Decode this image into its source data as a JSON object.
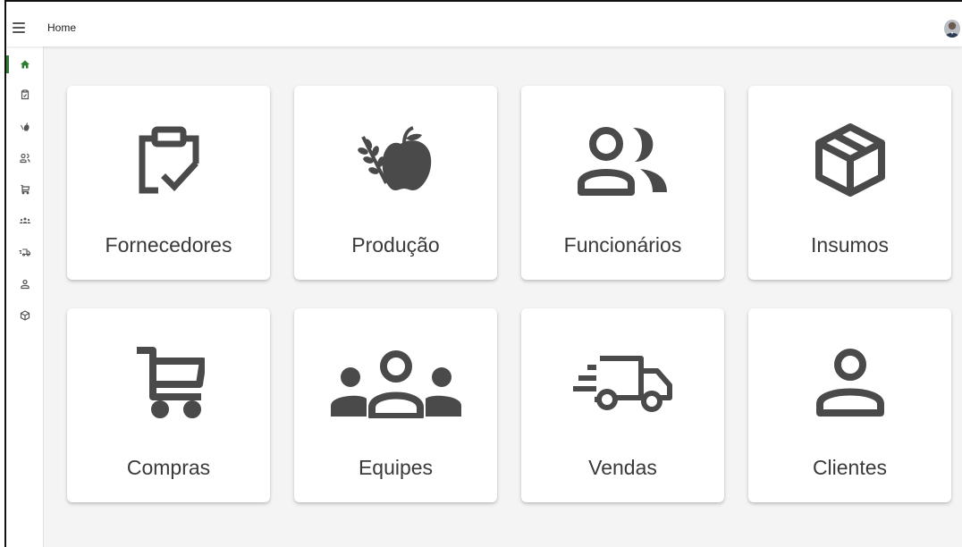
{
  "header": {
    "title": "Home",
    "menu_icon": "hamburger-menu-icon",
    "avatar_icon": "user-avatar"
  },
  "colors": {
    "icon": "#4a4a4a",
    "active_nav": "#2e7d32",
    "background": "#f4f4f4",
    "card": "#ffffff"
  },
  "sidebar": {
    "items": [
      {
        "icon": "home-icon",
        "active": true
      },
      {
        "icon": "clipboard-check-icon"
      },
      {
        "icon": "apple-wheat-icon"
      },
      {
        "icon": "users-icon"
      },
      {
        "icon": "cart-icon"
      },
      {
        "icon": "team-icon"
      },
      {
        "icon": "truck-icon"
      },
      {
        "icon": "person-icon"
      },
      {
        "icon": "box-icon"
      }
    ]
  },
  "cards": [
    {
      "label": "Fornecedores",
      "icon": "clipboard-check-icon"
    },
    {
      "label": "Produção",
      "icon": "apple-wheat-icon"
    },
    {
      "label": "Funcionários",
      "icon": "users-icon"
    },
    {
      "label": "Insumos",
      "icon": "box-icon"
    },
    {
      "label": "Compras",
      "icon": "cart-icon"
    },
    {
      "label": "Equipes",
      "icon": "team-icon"
    },
    {
      "label": "Vendas",
      "icon": "truck-icon"
    },
    {
      "label": "Clientes",
      "icon": "person-icon"
    }
  ]
}
